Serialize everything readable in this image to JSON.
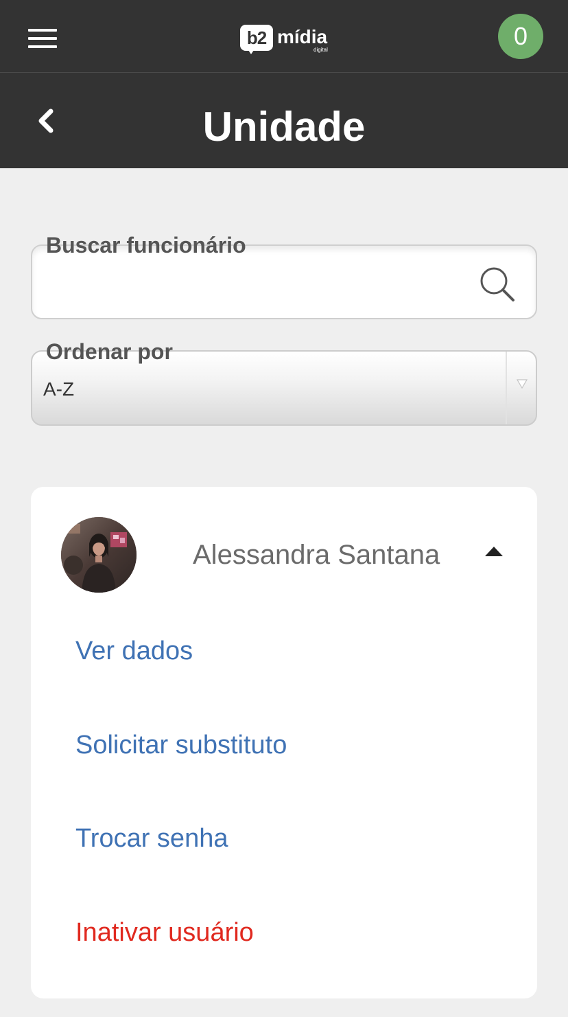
{
  "header": {
    "logo_badge": "b2",
    "logo_word": "mídia",
    "logo_sub": "digital",
    "counter": "0"
  },
  "title_bar": {
    "title": "Unidade"
  },
  "search": {
    "label": "Buscar funcionário",
    "value": "",
    "placeholder": ""
  },
  "sort": {
    "label": "Ordenar por",
    "selected": "A-Z"
  },
  "employee": {
    "name": "Alessandra Santana",
    "expanded": true,
    "actions": [
      {
        "label": "Ver dados"
      },
      {
        "label": "Solicitar substituto"
      },
      {
        "label": "Trocar senha"
      },
      {
        "label": "Inativar usuário"
      }
    ]
  },
  "colors": {
    "header_bg": "#333333",
    "page_bg": "#efefef",
    "badge_green": "#6fae6a",
    "link_blue": "#3f72b4",
    "danger_red": "#e0291f"
  },
  "icons": [
    "menu-icon",
    "back-chevron-icon",
    "search-icon",
    "dropdown-arrow-icon",
    "caret-up-icon"
  ]
}
